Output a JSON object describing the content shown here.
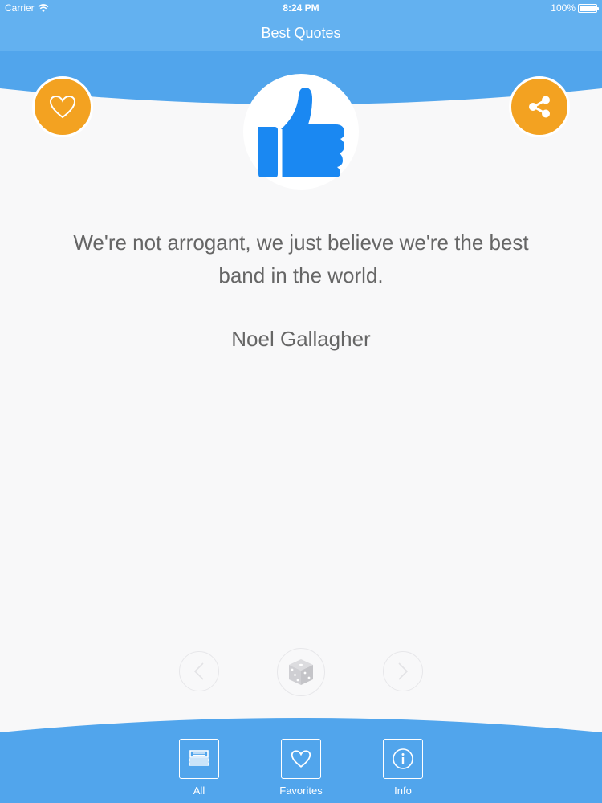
{
  "status_bar": {
    "carrier": "Carrier",
    "time": "8:24 PM",
    "battery": "100%"
  },
  "nav": {
    "title": "Best Quotes"
  },
  "quote": {
    "text": "We're not arrogant, we just believe we're the best band in the world.",
    "author": "Noel Gallagher"
  },
  "icons": {
    "favorite": "heart-icon",
    "share": "share-icon",
    "logo": "thumbs-up-icon",
    "previous": "chevron-left-icon",
    "random": "dice-icon",
    "next": "chevron-right-icon"
  },
  "tabs": [
    {
      "label": "All",
      "icon": "stack-icon"
    },
    {
      "label": "Favorites",
      "icon": "heart-icon"
    },
    {
      "label": "Info",
      "icon": "info-icon"
    }
  ],
  "colors": {
    "primary_blue": "#63b1f0",
    "header_wave": "#51a5ec",
    "accent_orange": "#f3a221",
    "logo_blue": "#1a88f2",
    "text_gray": "#666666",
    "background": "#f8f8f9"
  }
}
